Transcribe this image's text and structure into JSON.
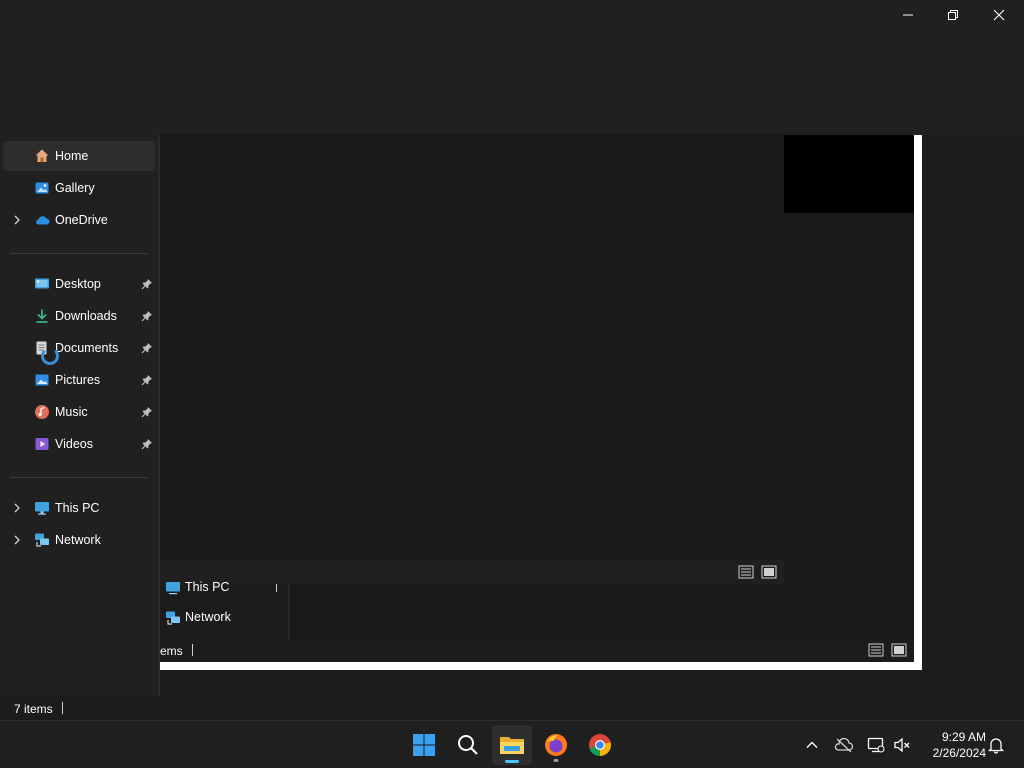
{
  "window": {
    "controls": {
      "minimize": "minimize-icon",
      "restore": "restore-icon",
      "close": "close-icon"
    }
  },
  "sidebar": {
    "items": [
      {
        "label": "Home",
        "icon": "home-icon",
        "selected": true
      },
      {
        "label": "Gallery",
        "icon": "gallery-icon"
      },
      {
        "label": "OneDrive",
        "icon": "onedrive-icon",
        "expandable": true
      },
      {
        "label": "Desktop",
        "icon": "desktop-folder-icon",
        "pinned": true
      },
      {
        "label": "Downloads",
        "icon": "downloads-icon",
        "pinned": true
      },
      {
        "label": "Documents",
        "icon": "documents-icon",
        "pinned": true
      },
      {
        "label": "Pictures",
        "icon": "pictures-icon",
        "pinned": true
      },
      {
        "label": "Music",
        "icon": "music-icon",
        "pinned": true
      },
      {
        "label": "Videos",
        "icon": "videos-icon",
        "pinned": true
      },
      {
        "label": "This PC",
        "icon": "this-pc-icon",
        "expandable": true
      },
      {
        "label": "Network",
        "icon": "network-icon",
        "expandable": true
      }
    ]
  },
  "ghost_window": {
    "nav_items": [
      {
        "label": "This PC"
      },
      {
        "label": "Network"
      }
    ],
    "status_text": "ems"
  },
  "status": {
    "item_count": "7 items"
  },
  "taskbar": {
    "apps": [
      "start-icon",
      "search-icon",
      "file-explorer-icon",
      "firefox-icon",
      "chrome-icon"
    ],
    "clock": {
      "time": "9:29 AM",
      "date": "2/26/2024"
    }
  },
  "colors": {
    "accent": "#4cc2ff",
    "background": "#1c1c1c",
    "content": "#191919"
  }
}
